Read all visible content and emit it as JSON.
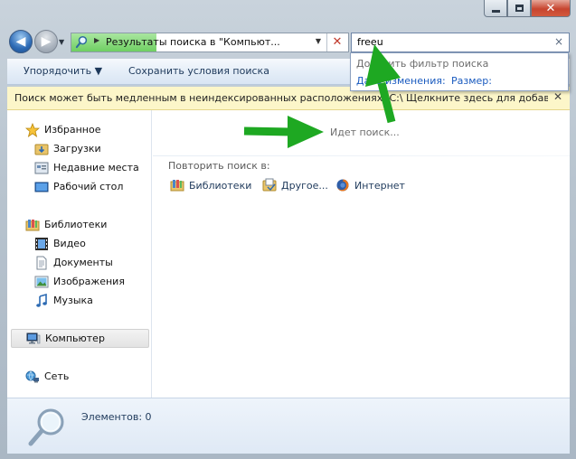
{
  "window": {
    "caption_buttons": {
      "minimize": "minimize",
      "maximize": "maximize",
      "close": "✕"
    }
  },
  "address_bar": {
    "path_text": "Результаты поиска в \"Компьют...",
    "clear_label": "✕"
  },
  "search": {
    "query": "freeu",
    "clear_label": "×",
    "suggestions": {
      "title": "Добавить фильтр поиска",
      "date_link": "Дата изменения:",
      "size_link": "Размер:"
    }
  },
  "toolbar": {
    "organize_label": "Упорядочить ▼",
    "save_search_label": "Сохранить условия поиска"
  },
  "infobar": {
    "message": "Поиск может быть медленным в неиндексированных расположениях: C:\\ Щелкните здесь для добавл...",
    "close_label": "✕"
  },
  "nav_pane": {
    "favorites": {
      "label": "Избранное",
      "icon": "star-icon",
      "items": [
        {
          "label": "Загрузки",
          "icon": "downloads-folder-icon"
        },
        {
          "label": "Недавние места",
          "icon": "recent-places-icon"
        },
        {
          "label": "Рабочий стол",
          "icon": "desktop-icon"
        }
      ]
    },
    "libraries": {
      "label": "Библиотеки",
      "icon": "libraries-icon",
      "items": [
        {
          "label": "Видео",
          "icon": "video-icon"
        },
        {
          "label": "Документы",
          "icon": "documents-icon"
        },
        {
          "label": "Изображения",
          "icon": "pictures-icon"
        },
        {
          "label": "Музыка",
          "icon": "music-icon"
        }
      ]
    },
    "computer": {
      "label": "Компьютер",
      "icon": "computer-icon"
    },
    "network": {
      "label": "Сеть",
      "icon": "network-icon"
    }
  },
  "results": {
    "status": "Идет поиск...",
    "repeat_header": "Повторить поиск в:",
    "repeat_items": [
      {
        "label": "Библиотеки",
        "icon": "libraries-icon"
      },
      {
        "label": "Другое...",
        "icon": "other-folder-icon"
      },
      {
        "label": "Интернет",
        "icon": "firefox-icon"
      }
    ]
  },
  "details_pane": {
    "count_text": "Элементов: 0",
    "icon": "magnifier-icon"
  },
  "colors": {
    "annotation_arrow": "#1ea822",
    "link": "#1a5bbf",
    "infobar": "#fcf6c9"
  }
}
